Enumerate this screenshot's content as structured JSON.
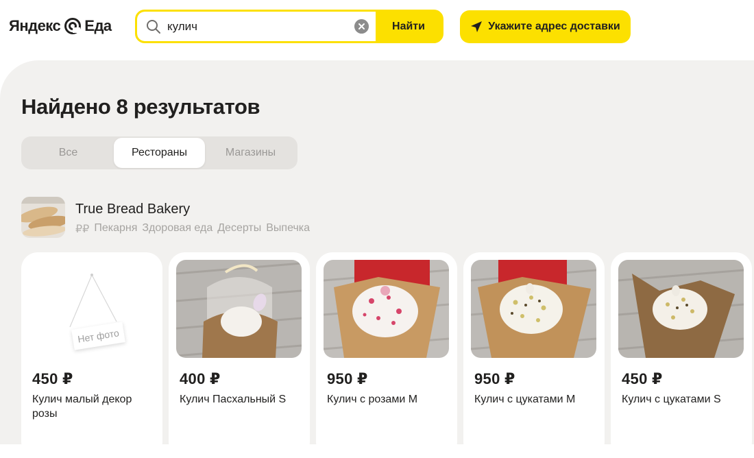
{
  "header": {
    "logo_left": "Яндекс",
    "logo_right": "Еда",
    "search": {
      "value": "кулич",
      "placeholder": "",
      "button_label": "Найти"
    },
    "address_button_label": "Укажите адрес доставки"
  },
  "main": {
    "title": "Найдено 8 результатов",
    "tabs": [
      {
        "label": "Все",
        "active": false
      },
      {
        "label": "Рестораны",
        "active": true
      },
      {
        "label": "Магазины",
        "active": false
      }
    ],
    "restaurant": {
      "name": "True Bread Bakery",
      "price_level": "₽₽",
      "tags": [
        "Пекарня",
        "Здоровая еда",
        "Десерты",
        "Выпечка"
      ]
    },
    "products": [
      {
        "price": "450 ₽",
        "name": "Кулич малый декор розы",
        "photo": "no-photo",
        "no_photo_label": "Нет фото"
      },
      {
        "price": "400 ₽",
        "name": "Кулич Пасхальный S",
        "photo": "kulich-ribbon"
      },
      {
        "price": "950 ₽",
        "name": "Кулич с розами М",
        "photo": "kulich-roses"
      },
      {
        "price": "950 ₽",
        "name": "Кулич с цукатами М",
        "photo": "kulich-candied"
      },
      {
        "price": "450 ₽",
        "name": "Кулич с цукатами S",
        "photo": "kulich-candied-small"
      }
    ]
  },
  "colors": {
    "accent": "#fce000",
    "background": "#f2f1ef",
    "text": "#21201f",
    "muted": "#a6a4a1"
  }
}
